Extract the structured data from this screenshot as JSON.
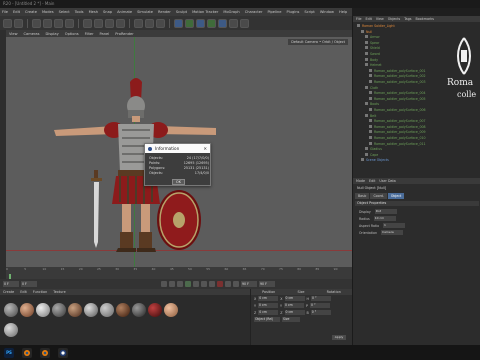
{
  "titlebar": {
    "text": "R20 - [Untitled 2 *] - Main"
  },
  "menubar": {
    "items": [
      "File",
      "Edit",
      "Create",
      "Modes",
      "Select",
      "Tools",
      "Mesh",
      "Snap",
      "Animate",
      "Simulate",
      "Render",
      "Sculpt",
      "Motion Tracker",
      "MoGraph",
      "Character",
      "Pipeline",
      "Plugins",
      "Script",
      "Window",
      "Help"
    ]
  },
  "view_menu": {
    "items": [
      "View",
      "Cameras",
      "Display",
      "Options",
      "Filter",
      "Panel",
      "ProRender"
    ]
  },
  "viewport": {
    "camera_label": "Default Camera • Orbit / Object"
  },
  "timeline": {
    "ticks": [
      "0",
      "5",
      "10",
      "15",
      "20",
      "25",
      "30",
      "35",
      "40",
      "45",
      "50",
      "55",
      "60",
      "65",
      "70",
      "75",
      "80",
      "85",
      "90"
    ],
    "current_frame": "0 F",
    "start_frame": "0 F",
    "end_frame": "90 F",
    "end_frame_2": "90 F"
  },
  "materials_menu": {
    "items": [
      "Create",
      "Edit",
      "Function",
      "Texture"
    ]
  },
  "object_panel": {
    "menu": [
      "File",
      "Edit",
      "View",
      "Objects",
      "Tags",
      "Bookmarks"
    ],
    "items": [
      {
        "label": "Roman Soldier_Light",
        "color": "orange",
        "indent": 0
      },
      {
        "label": "Null",
        "color": "orange",
        "indent": 1
      },
      {
        "label": "Armor",
        "color": "green",
        "indent": 2
      },
      {
        "label": "Spear",
        "color": "green",
        "indent": 2
      },
      {
        "label": "Shield",
        "color": "green",
        "indent": 2
      },
      {
        "label": "Sword",
        "color": "green",
        "indent": 2
      },
      {
        "label": "Body",
        "color": "green",
        "indent": 2
      },
      {
        "label": "Helmet",
        "color": "green",
        "indent": 2
      },
      {
        "label": "Roman_soldier_polySurface_001",
        "color": "green",
        "indent": 3
      },
      {
        "label": "Roman_soldier_polySurface_002",
        "color": "green",
        "indent": 3
      },
      {
        "label": "Roman_soldier_polySurface_003",
        "color": "green",
        "indent": 3
      },
      {
        "label": "Cloth",
        "color": "green",
        "indent": 2
      },
      {
        "label": "Roman_soldier_polySurface_004",
        "color": "green",
        "indent": 3
      },
      {
        "label": "Roman_soldier_polySurface_005",
        "color": "green",
        "indent": 3
      },
      {
        "label": "Boots",
        "color": "green",
        "indent": 2
      },
      {
        "label": "Roman_soldier_polySurface_006",
        "color": "green",
        "indent": 3
      },
      {
        "label": "Belt",
        "color": "green",
        "indent": 2
      },
      {
        "label": "Roman_soldier_polySurface_007",
        "color": "green",
        "indent": 3
      },
      {
        "label": "Roman_soldier_polySurface_008",
        "color": "green",
        "indent": 3
      },
      {
        "label": "Roman_soldier_polySurface_009",
        "color": "green",
        "indent": 3
      },
      {
        "label": "Roman_soldier_polySurface_010",
        "color": "green",
        "indent": 3
      },
      {
        "label": "Roman_soldier_polySurface_011",
        "color": "green",
        "indent": 3
      },
      {
        "label": "Gladius",
        "color": "green",
        "indent": 2
      },
      {
        "label": "Cape",
        "color": "green",
        "indent": 2
      },
      {
        "label": "Scene Objects",
        "color": "blue",
        "indent": 1
      }
    ]
  },
  "attr_panel": {
    "menu": [
      "Mode",
      "Edit",
      "User Data"
    ],
    "subtitle": "Null Object [Null]",
    "tabs": [
      "Basic",
      "Coord.",
      "Object"
    ],
    "active_tab": "Object",
    "section_title": "Object Properties",
    "rows": [
      {
        "label": "Display",
        "value": "Dot"
      },
      {
        "label": "Radius",
        "value": "10 cm"
      },
      {
        "label": "Aspect Ratio",
        "value": "1"
      },
      {
        "label": "Orientation",
        "value": "Camera"
      }
    ]
  },
  "coord_panel": {
    "headers": [
      "Position",
      "Size",
      "Rotation"
    ],
    "rows": [
      {
        "axis": "X",
        "pos": "0 cm",
        "size": "0 cm",
        "rot_label": "H",
        "rot": "0 °"
      },
      {
        "axis": "Y",
        "pos": "0 cm",
        "size": "0 cm",
        "rot_label": "P",
        "rot": "0 °"
      },
      {
        "axis": "Z",
        "pos": "0 cm",
        "size": "0 cm",
        "rot_label": "B",
        "rot": "0 °"
      }
    ],
    "mode_select": "Object (Rel)",
    "size_select": "Size",
    "apply_label": "Apply"
  },
  "info_dialog": {
    "title": "Information",
    "rows": [
      {
        "label": "Objects:",
        "value": "24 (17/7/0/0)"
      },
      {
        "label": "Points:",
        "value": "12695 (12695)"
      },
      {
        "label": "Polygons:",
        "value": "25131 (25131)"
      },
      {
        "label": "Objects:",
        "value": "17/4/0/0"
      }
    ],
    "ok_label": "OK"
  },
  "logo": {
    "top_text": "Roma",
    "bottom_text": "colle"
  },
  "taskbar": {
    "icons": [
      "PS",
      "Blender",
      "Blender",
      "Cinema4D"
    ]
  },
  "colors": {
    "accent_orange": "#e08a3c",
    "object_green": "#6ea35a",
    "tab_blue": "#4b6d9a",
    "viewport_bg": "#5c5c5c"
  }
}
